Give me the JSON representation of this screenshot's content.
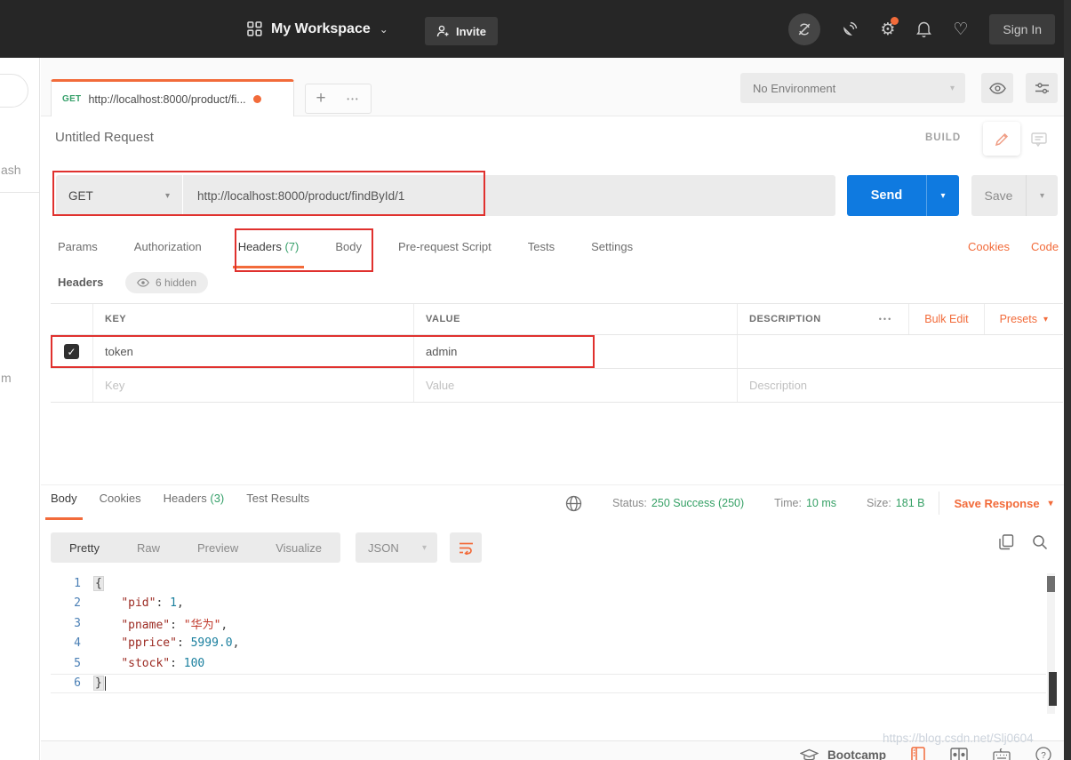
{
  "topbar": {
    "workspace": "My Workspace",
    "invite": "Invite",
    "sign_in": "Sign In"
  },
  "tabstrip": {
    "tab_method": "GET",
    "tab_title": "http://localhost:8000/product/fi...",
    "environment": "No Environment"
  },
  "request": {
    "title": "Untitled Request",
    "build_label": "BUILD",
    "method": "GET",
    "url": "http://localhost:8000/product/findById/1",
    "send_label": "Send",
    "save_label": "Save",
    "tabs": [
      {
        "label": "Params",
        "count": ""
      },
      {
        "label": "Authorization",
        "count": ""
      },
      {
        "label": "Headers",
        "count": "(7)"
      },
      {
        "label": "Body",
        "count": ""
      },
      {
        "label": "Pre-request Script",
        "count": ""
      },
      {
        "label": "Tests",
        "count": ""
      },
      {
        "label": "Settings",
        "count": ""
      }
    ],
    "cookies_link": "Cookies",
    "code_link": "Code"
  },
  "headers_editor": {
    "section_label": "Headers",
    "hidden_badge": "6 hidden",
    "columns": {
      "key": "KEY",
      "value": "VALUE",
      "description": "DESCRIPTION"
    },
    "bulk_edit": "Bulk Edit",
    "presets": "Presets",
    "rows": [
      {
        "key": "token",
        "value": "admin",
        "checked": true
      }
    ],
    "placeholders": {
      "key": "Key",
      "value": "Value",
      "description": "Description"
    }
  },
  "response": {
    "tabs": [
      {
        "label": "Body",
        "count": ""
      },
      {
        "label": "Cookies",
        "count": ""
      },
      {
        "label": "Headers",
        "count": "(3)"
      },
      {
        "label": "Test Results",
        "count": ""
      }
    ],
    "status_label": "Status:",
    "status_value": "250 Success (250)",
    "time_label": "Time:",
    "time_value": "10 ms",
    "size_label": "Size:",
    "size_value": "181 B",
    "save_response": "Save Response",
    "view_modes": {
      "pretty": "Pretty",
      "raw": "Raw",
      "preview": "Preview",
      "visualize": "Visualize"
    },
    "format": "JSON",
    "code": {
      "active_line": 6,
      "lines": [
        {
          "n": 1,
          "tokens": [
            {
              "t": "{",
              "c": "brace"
            }
          ]
        },
        {
          "n": 2,
          "tokens": [
            {
              "t": "    ",
              "c": "pun"
            },
            {
              "t": "\"pid\"",
              "c": "key"
            },
            {
              "t": ": ",
              "c": "pun"
            },
            {
              "t": "1",
              "c": "num"
            },
            {
              "t": ",",
              "c": "pun"
            }
          ]
        },
        {
          "n": 3,
          "tokens": [
            {
              "t": "    ",
              "c": "pun"
            },
            {
              "t": "\"pname\"",
              "c": "key"
            },
            {
              "t": ": ",
              "c": "pun"
            },
            {
              "t": "\"华为\"",
              "c": "str"
            },
            {
              "t": ",",
              "c": "pun"
            }
          ]
        },
        {
          "n": 4,
          "tokens": [
            {
              "t": "    ",
              "c": "pun"
            },
            {
              "t": "\"pprice\"",
              "c": "key"
            },
            {
              "t": ": ",
              "c": "pun"
            },
            {
              "t": "5999.0",
              "c": "num"
            },
            {
              "t": ",",
              "c": "pun"
            }
          ]
        },
        {
          "n": 5,
          "tokens": [
            {
              "t": "    ",
              "c": "pun"
            },
            {
              "t": "\"stock\"",
              "c": "key"
            },
            {
              "t": ": ",
              "c": "pun"
            },
            {
              "t": "100",
              "c": "num"
            }
          ]
        },
        {
          "n": 6,
          "tokens": [
            {
              "t": "}",
              "c": "brace"
            }
          ]
        }
      ]
    }
  },
  "footer": {
    "bootcamp": "Bootcamp",
    "watermark": "https://blog.csdn.net/Slj0604"
  },
  "sidebar": {
    "fragment_top": "ash",
    "fragment_bottom": "m"
  },
  "glyphs": {
    "caret": "▾",
    "plus": "+",
    "dots": "•••",
    "gear": "⚙",
    "heart": "♡",
    "check": "✓",
    "question": "?"
  },
  "colors": {
    "accent_orange": "#f26b3a",
    "send_blue": "#0f7ae0",
    "success_green": "#35a065",
    "annotation_red": "#e0312e",
    "topbar_dark": "#262626"
  }
}
